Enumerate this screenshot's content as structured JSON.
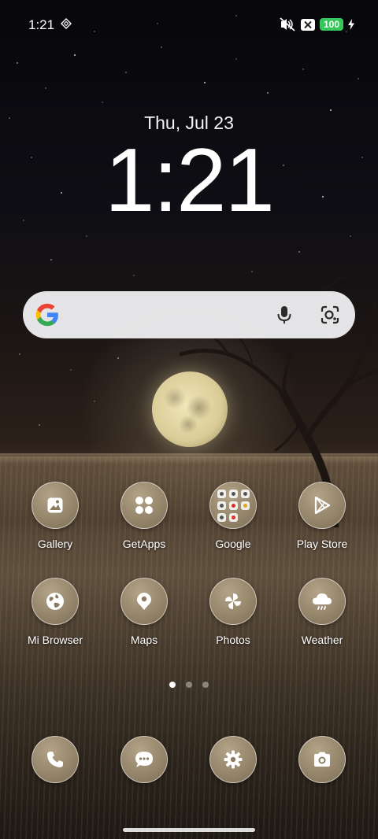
{
  "status_bar": {
    "time": "1:21",
    "battery": "100",
    "icons": [
      "diamond-notification-icon",
      "mute-icon",
      "no-sim-icon",
      "battery-icon",
      "charging-bolt-icon"
    ]
  },
  "clock": {
    "date": "Thu, Jul 23",
    "time": "1:21"
  },
  "search": {
    "icons": [
      "google-logo-icon",
      "mic-icon",
      "lens-icon"
    ]
  },
  "apps": [
    {
      "label": "Gallery",
      "icon": "gallery-icon"
    },
    {
      "label": "GetApps",
      "icon": "getapps-icon"
    },
    {
      "label": "Google",
      "icon": "folder-icon"
    },
    {
      "label": "Play Store",
      "icon": "play-store-icon"
    },
    {
      "label": "Mi Browser",
      "icon": "globe-icon"
    },
    {
      "label": "Maps",
      "icon": "map-pin-icon"
    },
    {
      "label": "Photos",
      "icon": "pinwheel-icon"
    },
    {
      "label": "Weather",
      "icon": "weather-icon"
    }
  ],
  "page_indicator": {
    "pages": 3,
    "current": 1
  },
  "dock": [
    {
      "icon": "phone-icon"
    },
    {
      "icon": "messages-icon"
    },
    {
      "icon": "settings-icon"
    },
    {
      "icon": "camera-icon"
    }
  ],
  "colors": {
    "battery": "#34c759",
    "search_bar": "#ececee",
    "icon_bg": "#8a7b62"
  }
}
